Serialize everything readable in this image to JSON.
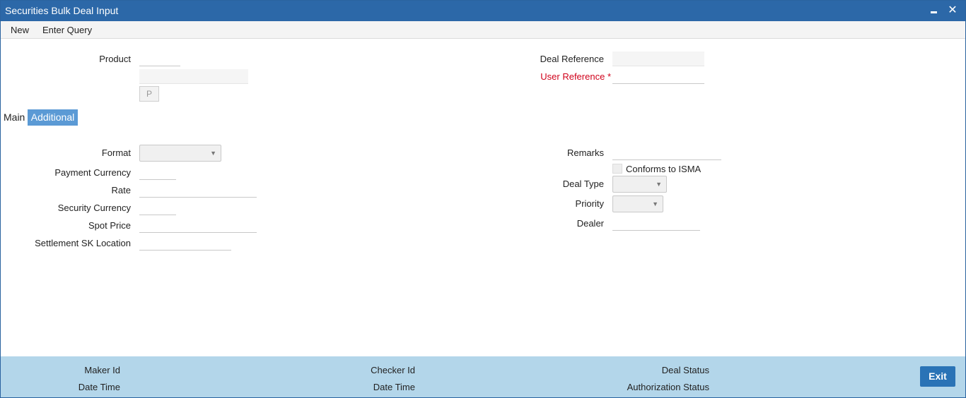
{
  "window": {
    "title": "Securities Bulk Deal Input"
  },
  "menu": {
    "new_label": "New",
    "enter_query_label": "Enter Query"
  },
  "header": {
    "product_label": "Product",
    "product_code": "",
    "product_desc": "",
    "p_button_label": "P",
    "deal_reference_label": "Deal Reference",
    "deal_reference": "",
    "user_reference_label": "User Reference",
    "user_reference_required": "*",
    "user_reference": ""
  },
  "tabs": [
    {
      "label": "Main",
      "active": false
    },
    {
      "label": "Additional",
      "active": true
    }
  ],
  "form": {
    "format_label": "Format",
    "format_value": "",
    "payment_currency_label": "Payment Currency",
    "payment_currency": "",
    "rate_label": "Rate",
    "rate": "",
    "security_currency_label": "Security Currency",
    "security_currency": "",
    "spot_price_label": "Spot Price",
    "spot_price": "",
    "settlement_sk_location_label": "Settlement SK Location",
    "settlement_sk_location": "",
    "remarks_label": "Remarks",
    "remarks": "",
    "conforms_isma_label": "Conforms to ISMA",
    "conforms_isma_checked": false,
    "deal_type_label": "Deal Type",
    "deal_type_value": "",
    "priority_label": "Priority",
    "priority_value": "",
    "dealer_label": "Dealer",
    "dealer": ""
  },
  "footer": {
    "maker_id_label": "Maker Id",
    "maker_date_time_label": "Date Time",
    "checker_id_label": "Checker Id",
    "checker_date_time_label": "Date Time",
    "deal_status_label": "Deal Status",
    "authorization_status_label": "Authorization Status",
    "exit_label": "Exit"
  },
  "colors": {
    "titlebar": "#2c68a8",
    "footer": "#b3d6ea",
    "active_tab": "#5b9ad5",
    "required": "#d0021b",
    "exit_button": "#2a73b6"
  }
}
